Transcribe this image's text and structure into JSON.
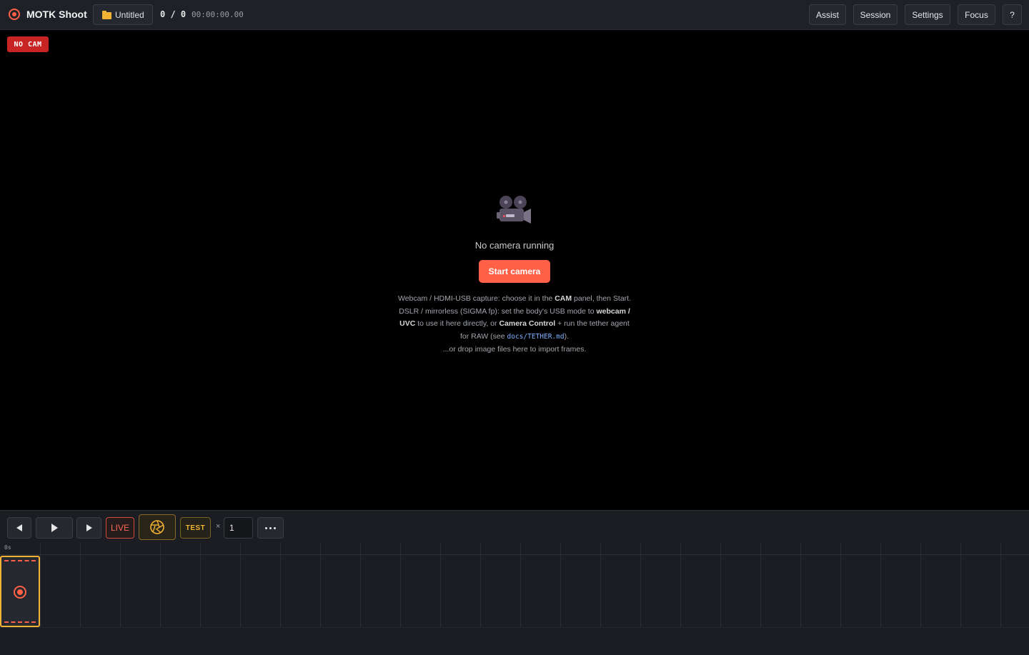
{
  "header": {
    "app_title": "MOTK Shoot",
    "project_name": "Untitled",
    "frame_counter": "0 / 0",
    "timecode": "00:00:00.00",
    "nav": {
      "assist": "Assist",
      "session": "Session",
      "settings": "Settings",
      "focus": "Focus",
      "help": "?"
    }
  },
  "viewport": {
    "status_badge": "NO CAM",
    "message": "No camera running",
    "start_label": "Start camera",
    "help_lines": {
      "l1_a": "Webcam / HDMI-USB capture: choose it in the ",
      "l1_b": "CAM",
      "l1_c": " panel, then Start.",
      "l2_a": "DSLR / mirrorless (SIGMA fp): set the body's USB mode to ",
      "l2_b": "webcam /",
      "l3_a": "UVC",
      "l3_b": " to use it here directly, or ",
      "l3_c": "Camera Control",
      "l3_d": " + run the tether agent",
      "l4_a": "for RAW (see ",
      "l4_code": "docs/TETHER.md",
      "l4_b": ")."
    },
    "drop_hint": "...or drop image files here to import frames."
  },
  "toolbar": {
    "live_label": "LIVE",
    "test_label": "TEST",
    "times_symbol": "×",
    "shoot_count": "1"
  },
  "timeline": {
    "ruler_start": "0s"
  },
  "icons": {
    "logo": "record-icon",
    "project": "folder-icon",
    "camera": "movie-camera-icon",
    "prev": "step-back-icon",
    "play": "play-icon",
    "next": "step-forward-icon",
    "onion": "aperture-icon",
    "more": "more-icon",
    "frame": "record-icon"
  },
  "colors": {
    "accent": "#ff6046",
    "live": "#ff6a55",
    "test": "#f2b233",
    "nocam": "#c82424"
  }
}
